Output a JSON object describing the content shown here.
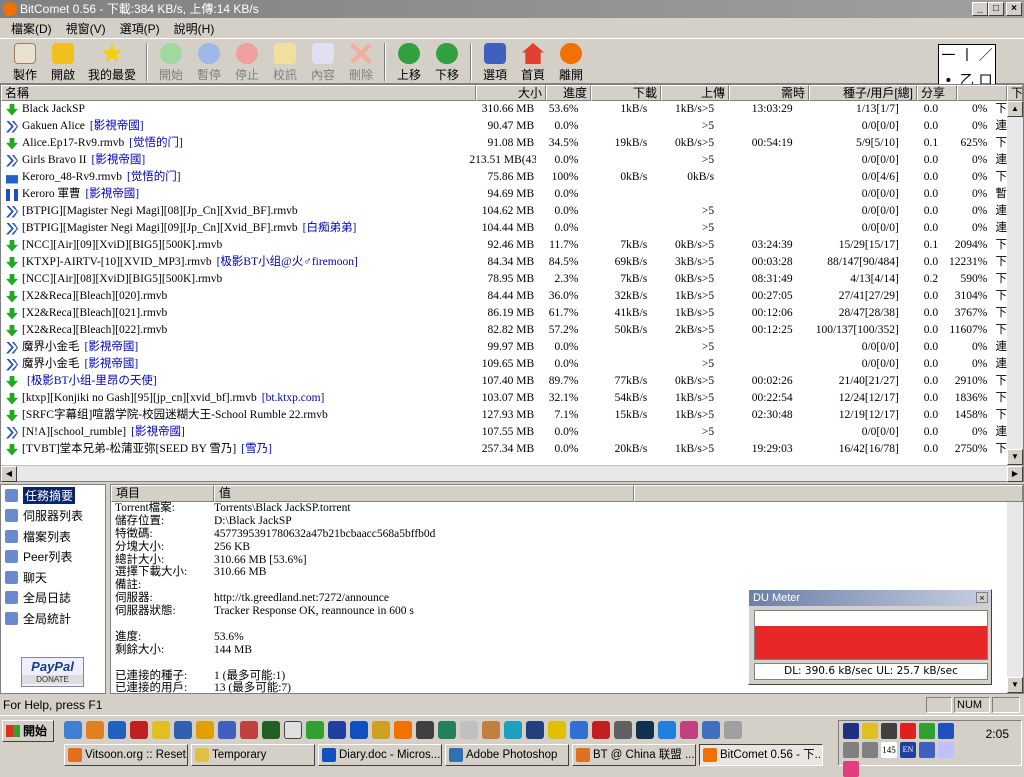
{
  "window": {
    "title": "BitComet 0.56 - 下載:384 KB/s, 上傳:14 KB/s",
    "buttons": {
      "min": "_",
      "max": "□",
      "close": "×"
    }
  },
  "menu": [
    "檔案(D)",
    "視窗(V)",
    "選項(P)",
    "說明(H)"
  ],
  "toolbar": {
    "make": "製作",
    "open": "開啟",
    "favorites": "我的最愛",
    "start": "開始",
    "pause": "暫停",
    "stop": "停止",
    "check": "校訊",
    "content": "內容",
    "delete": "刪除",
    "move_up": "上移",
    "move_down": "下移",
    "options": "選項",
    "home": "首頁",
    "exit": "離開"
  },
  "ime": {
    "cells": [
      "一",
      "丨",
      "／",
      "•",
      "乙",
      "口",
      "✚",
      "✕",
      "冖"
    ],
    "label": "選字",
    "extra": "傳"
  },
  "columns": [
    "名稱",
    "大小",
    "進度",
    "下載",
    "上傳",
    "需時",
    "種子/用戶[總]",
    "分享",
    "下"
  ],
  "torrents": [
    {
      "icon": "down",
      "name": "Black JackSP",
      "tag": "",
      "size": "310.66 MB",
      "progress": "53.6%",
      "down": "1kB/s",
      "up": "1kB/s>5",
      "time": "13:03:29",
      "seeds": "1/13[1/7]",
      "ratio": "0.0",
      "pct": "0%",
      "st": "下"
    },
    {
      "icon": "queue",
      "name": "Gakuen Alice",
      "tag": "[影視帝國]",
      "size": "90.47 MB",
      "progress": "0.0%",
      "down": "",
      "up": ">5",
      "time": "",
      "seeds": "0/0[0/0]",
      "ratio": "0.0",
      "pct": "0%",
      "st": "連"
    },
    {
      "icon": "down",
      "name": "Alice.Ep17-Rv9.rmvb",
      "tag": "[觉悟的门]",
      "size": "91.08 MB",
      "progress": "34.5%",
      "down": "19kB/s",
      "up": "0kB/s>5",
      "time": "00:54:19",
      "seeds": "5/9[5/10]",
      "ratio": "0.1",
      "pct": "625%",
      "st": "下"
    },
    {
      "icon": "queue",
      "name": "Girls Bravo II",
      "tag": "[影視帝國]",
      "size": "213.51 MB(434.2...",
      "progress": "0.0%",
      "down": "",
      "up": ">5",
      "time": "",
      "seeds": "0/0[0/0]",
      "ratio": "0.0",
      "pct": "0%",
      "st": "連"
    },
    {
      "icon": "done",
      "name": "Keroro_48-Rv9.rmvb",
      "tag": "[觉悟的门]",
      "size": "75.86 MB",
      "progress": "100%",
      "down": "0kB/s",
      "up": "0kB/s",
      "time": "",
      "seeds": "0/0[4/6]",
      "ratio": "0.0",
      "pct": "0%",
      "st": "下"
    },
    {
      "icon": "pause",
      "name": "Keroro 軍曹",
      "tag": "[影視帝國]",
      "size": "94.69 MB",
      "progress": "0.0%",
      "down": "",
      "up": "",
      "time": "",
      "seeds": "0/0[0/0]",
      "ratio": "0.0",
      "pct": "0%",
      "st": "暫"
    },
    {
      "icon": "queue",
      "name": "[BTPIG][Magister Negi Magi][08][Jp_Cn][Xvid_BF].rmvb",
      "tag": "",
      "size": "104.62 MB",
      "progress": "0.0%",
      "down": "",
      "up": ">5",
      "time": "",
      "seeds": "0/0[0/0]",
      "ratio": "0.0",
      "pct": "0%",
      "st": "連"
    },
    {
      "icon": "queue",
      "name": "[BTPIG][Magister Negi Magi][09][Jp_Cn][Xvid_BF].rmvb",
      "tag": "[白痴弟弟]",
      "size": "104.44 MB",
      "progress": "0.0%",
      "down": "",
      "up": ">5",
      "time": "",
      "seeds": "0/0[0/0]",
      "ratio": "0.0",
      "pct": "0%",
      "st": "連"
    },
    {
      "icon": "down",
      "name": "[NCC][Air][09][XviD][BIG5][500K].rmvb",
      "tag": "",
      "size": "92.46 MB",
      "progress": "11.7%",
      "down": "7kB/s",
      "up": "0kB/s>5",
      "time": "03:24:39",
      "seeds": "15/29[15/17]",
      "ratio": "0.1",
      "pct": "2094%",
      "st": "下"
    },
    {
      "icon": "down",
      "name": "[KTXP]-AIRTV-[10][XVID_MP3].rmvb",
      "tag": "[极影BT小组@火♂firemoon]",
      "size": "84.34 MB",
      "progress": "84.5%",
      "down": "69kB/s",
      "up": "3kB/s>5",
      "time": "00:03:28",
      "seeds": "88/147[90/484]",
      "ratio": "0.0",
      "pct": "12231%",
      "st": "下"
    },
    {
      "icon": "down",
      "name": "[NCC][Air][08][XviD][BIG5][500K].rmvb",
      "tag": "",
      "size": "78.95 MB",
      "progress": "2.3%",
      "down": "7kB/s",
      "up": "0kB/s>5",
      "time": "08:31:49",
      "seeds": "4/13[4/14]",
      "ratio": "0.2",
      "pct": "590%",
      "st": "下"
    },
    {
      "icon": "down",
      "name": "[X2&Reca][Bleach][020].rmvb",
      "tag": "",
      "size": "84.44 MB",
      "progress": "36.0%",
      "down": "32kB/s",
      "up": "1kB/s>5",
      "time": "00:27:05",
      "seeds": "27/41[27/29]",
      "ratio": "0.0",
      "pct": "3104%",
      "st": "下"
    },
    {
      "icon": "down",
      "name": "[X2&Reca][Bleach][021].rmvb",
      "tag": "",
      "size": "86.19 MB",
      "progress": "61.7%",
      "down": "41kB/s",
      "up": "1kB/s>5",
      "time": "00:12:06",
      "seeds": "28/47[28/38]",
      "ratio": "0.0",
      "pct": "3767%",
      "st": "下"
    },
    {
      "icon": "down",
      "name": "[X2&Reca][Bleach][022].rmvb",
      "tag": "",
      "size": "82.82 MB",
      "progress": "57.2%",
      "down": "50kB/s",
      "up": "2kB/s>5",
      "time": "00:12:25",
      "seeds": "100/137[100/352]",
      "ratio": "0.0",
      "pct": "11607%",
      "st": "下"
    },
    {
      "icon": "queue",
      "name": "魔界小金毛",
      "tag": "[影視帝國]",
      "size": "99.97 MB",
      "progress": "0.0%",
      "down": "",
      "up": ">5",
      "time": "",
      "seeds": "0/0[0/0]",
      "ratio": "0.0",
      "pct": "0%",
      "st": "連"
    },
    {
      "icon": "queue",
      "name": "魔界小金毛",
      "tag": "[影視帝國]",
      "size": "109.65 MB",
      "progress": "0.0%",
      "down": "",
      "up": ">5",
      "time": "",
      "seeds": "0/0[0/0]",
      "ratio": "0.0",
      "pct": "0%",
      "st": "連"
    },
    {
      "icon": "down",
      "name": "",
      "tag": "[极影BT小组-里昂の天使]",
      "size": "107.40 MB",
      "progress": "89.7%",
      "down": "77kB/s",
      "up": "0kB/s>5",
      "time": "00:02:26",
      "seeds": "21/40[21/27]",
      "ratio": "0.0",
      "pct": "2910%",
      "st": "下"
    },
    {
      "icon": "down",
      "name": "[ktxp][Konjiki no Gash][95][jp_cn][xvid_bf].rmvb",
      "tag": "[bt.ktxp.com]",
      "size": "103.07 MB",
      "progress": "32.1%",
      "down": "54kB/s",
      "up": "1kB/s>5",
      "time": "00:22:54",
      "seeds": "12/24[12/17]",
      "ratio": "0.0",
      "pct": "1836%",
      "st": "下"
    },
    {
      "icon": "down",
      "name": "[SRFC字幕组]喧嚣学院-校园迷糊大王-School Rumble 22.rmvb",
      "tag": "",
      "size": "127.93 MB",
      "progress": "7.1%",
      "down": "15kB/s",
      "up": "1kB/s>5",
      "time": "02:30:48",
      "seeds": "12/19[12/17]",
      "ratio": "0.0",
      "pct": "1458%",
      "st": "下"
    },
    {
      "icon": "queue",
      "name": "[N!A][school_rumble]",
      "tag": "[影視帝國]",
      "size": "107.55 MB",
      "progress": "0.0%",
      "down": "",
      "up": ">5",
      "time": "",
      "seeds": "0/0[0/0]",
      "ratio": "0.0",
      "pct": "0%",
      "st": "連"
    },
    {
      "icon": "down",
      "name": "[TVBT]堂本兄弟-松蒲亚弥[SEED BY 雪乃]",
      "tag": "[雪乃]",
      "size": "257.34 MB",
      "progress": "0.0%",
      "down": "20kB/s",
      "up": "1kB/s>5",
      "time": "19:29:03",
      "seeds": "16/42[16/78]",
      "ratio": "0.0",
      "pct": "2750%",
      "st": "下"
    }
  ],
  "sidebar": [
    {
      "label": "任務摘要",
      "selected": true
    },
    {
      "label": "伺服器列表"
    },
    {
      "label": "檔案列表"
    },
    {
      "label": "Peer列表"
    },
    {
      "label": "聊天"
    },
    {
      "label": "全局日誌"
    },
    {
      "label": "全局統計"
    }
  ],
  "paypal": {
    "brand": "PayPal",
    "donate": "DONATE"
  },
  "detail": {
    "headers": [
      "項目",
      "值"
    ],
    "rows": [
      {
        "k": "Torrent檔案:",
        "v": "Torrents\\Black JackSP.torrent"
      },
      {
        "k": "儲存位置:",
        "v": "D:\\Black JackSP"
      },
      {
        "k": "特徵碼:",
        "v": "4577395391780632a47b21bcbaacc568a5bffb0d"
      },
      {
        "k": "分塊大小:",
        "v": "256 KB"
      },
      {
        "k": "總計大小:",
        "v": "310.66 MB [53.6%]"
      },
      {
        "k": "選擇下載大小:",
        "v": "310.66 MB"
      },
      {
        "k": "備註:",
        "v": ""
      },
      {
        "k": "伺服器:",
        "v": "http://tk.greedland.net:7272/announce"
      },
      {
        "k": "伺服器狀態:",
        "v": "Tracker Response OK, reannounce in 600 s"
      },
      {
        "k": "",
        "v": ""
      },
      {
        "k": "進度:",
        "v": "53.6%"
      },
      {
        "k": "剩餘大小:",
        "v": "144 MB"
      },
      {
        "k": "",
        "v": ""
      },
      {
        "k": "已連接的種子:",
        "v": "1 (最多可能:1)"
      },
      {
        "k": "已連接的用戶:",
        "v": "13 (最多可能:7)"
      }
    ]
  },
  "dumeter": {
    "title": "DU Meter",
    "reading": "DL: 390.6 kB/sec  UL: 25.7 kB/sec",
    "close": "×"
  },
  "status": {
    "text": "For Help, press F1",
    "num": "NUM"
  },
  "taskbar": {
    "start": "開始",
    "tasks": [
      "Vitsoon.org :: Reset...",
      "Temporary",
      "Diary.doc - Micros...",
      "Adobe Photoshop",
      "BT @ China 联盟 ...",
      "BitComet 0.56 - 下..."
    ],
    "clock": "2:05",
    "lang": "EN",
    "tray_num": "145"
  },
  "colors": {
    "link": "#0000c0",
    "down_icon": "#1faa1f",
    "graph": "#e82828",
    "selection": "#0a246a"
  }
}
